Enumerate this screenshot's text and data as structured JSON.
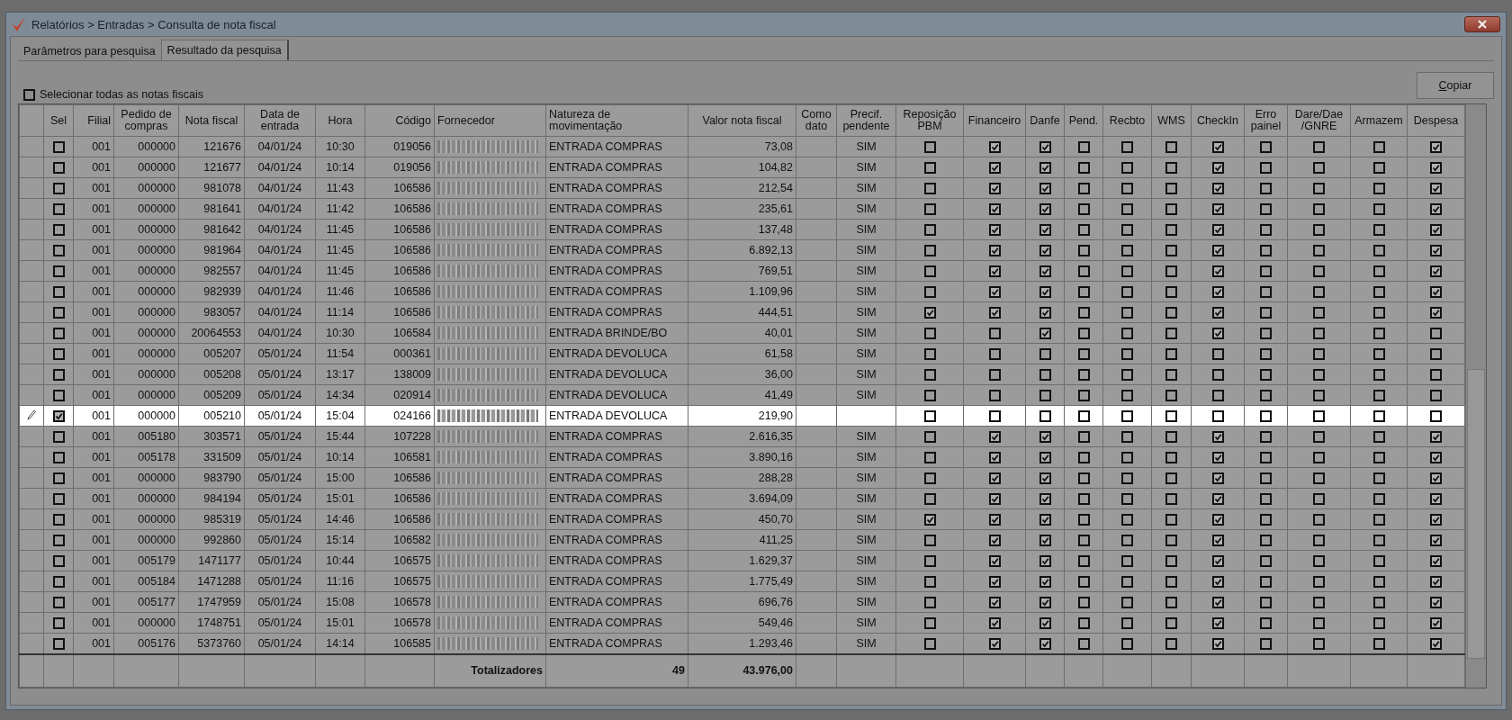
{
  "window": {
    "title": "Relatórios > Entradas > Consulta de nota fiscal"
  },
  "tabs": [
    {
      "label": "Parâmetros para pesquisa",
      "selected": false
    },
    {
      "label": "Resultado da pesquisa",
      "selected": true
    }
  ],
  "select_all": {
    "label": "Selecionar todas as notas fiscais",
    "checked": false
  },
  "copy_button": "Copiar",
  "table": {
    "columns": [
      "Sel",
      "Filial",
      "Pedido de\ncompras",
      "Nota fiscal",
      "Data de\nentrada",
      "Hora",
      "Código",
      "Fornecedor",
      "Natureza de\nmovimentação",
      "Valor nota fiscal",
      "Como\ndato",
      "Precif.\npendente",
      "Reposição\nPBM",
      "Financeiro",
      "Danfe",
      "Pend.",
      "Recbto",
      "WMS",
      "CheckIn",
      "Erro\npainel",
      "Dare/Dae\n/GNRE",
      "Armazem",
      "Despesa"
    ],
    "rows": [
      {
        "selected": false,
        "sel": false,
        "filial": "001",
        "pedido": "000000",
        "nota": "121676",
        "data": "04/01/24",
        "hora": "10:30",
        "codigo": "019056",
        "natureza": "ENTRADA COMPRAS",
        "valor": "73,08",
        "precif": "SIM",
        "checks": [
          false,
          true,
          true,
          false,
          false,
          false,
          true,
          false,
          false,
          false,
          true
        ]
      },
      {
        "selected": false,
        "sel": false,
        "filial": "001",
        "pedido": "000000",
        "nota": "121677",
        "data": "04/01/24",
        "hora": "10:14",
        "codigo": "019056",
        "natureza": "ENTRADA COMPRAS",
        "valor": "104,82",
        "precif": "SIM",
        "checks": [
          false,
          true,
          true,
          false,
          false,
          false,
          true,
          false,
          false,
          false,
          true
        ]
      },
      {
        "selected": false,
        "sel": false,
        "filial": "001",
        "pedido": "000000",
        "nota": "981078",
        "data": "04/01/24",
        "hora": "11:43",
        "codigo": "106586",
        "natureza": "ENTRADA COMPRAS",
        "valor": "212,54",
        "precif": "SIM",
        "checks": [
          false,
          true,
          true,
          false,
          false,
          false,
          true,
          false,
          false,
          false,
          true
        ]
      },
      {
        "selected": false,
        "sel": false,
        "filial": "001",
        "pedido": "000000",
        "nota": "981641",
        "data": "04/01/24",
        "hora": "11:42",
        "codigo": "106586",
        "natureza": "ENTRADA COMPRAS",
        "valor": "235,61",
        "precif": "SIM",
        "checks": [
          false,
          true,
          true,
          false,
          false,
          false,
          true,
          false,
          false,
          false,
          true
        ]
      },
      {
        "selected": false,
        "sel": false,
        "filial": "001",
        "pedido": "000000",
        "nota": "981642",
        "data": "04/01/24",
        "hora": "11:45",
        "codigo": "106586",
        "natureza": "ENTRADA COMPRAS",
        "valor": "137,48",
        "precif": "SIM",
        "checks": [
          false,
          true,
          true,
          false,
          false,
          false,
          true,
          false,
          false,
          false,
          true
        ]
      },
      {
        "selected": false,
        "sel": false,
        "filial": "001",
        "pedido": "000000",
        "nota": "981964",
        "data": "04/01/24",
        "hora": "11:45",
        "codigo": "106586",
        "natureza": "ENTRADA COMPRAS",
        "valor": "6.892,13",
        "precif": "SIM",
        "checks": [
          false,
          true,
          true,
          false,
          false,
          false,
          true,
          false,
          false,
          false,
          true
        ]
      },
      {
        "selected": false,
        "sel": false,
        "filial": "001",
        "pedido": "000000",
        "nota": "982557",
        "data": "04/01/24",
        "hora": "11:45",
        "codigo": "106586",
        "natureza": "ENTRADA COMPRAS",
        "valor": "769,51",
        "precif": "SIM",
        "checks": [
          false,
          true,
          true,
          false,
          false,
          false,
          true,
          false,
          false,
          false,
          true
        ]
      },
      {
        "selected": false,
        "sel": false,
        "filial": "001",
        "pedido": "000000",
        "nota": "982939",
        "data": "04/01/24",
        "hora": "11:46",
        "codigo": "106586",
        "natureza": "ENTRADA COMPRAS",
        "valor": "1.109,96",
        "precif": "SIM",
        "checks": [
          false,
          true,
          true,
          false,
          false,
          false,
          true,
          false,
          false,
          false,
          true
        ]
      },
      {
        "selected": false,
        "sel": false,
        "filial": "001",
        "pedido": "000000",
        "nota": "983057",
        "data": "04/01/24",
        "hora": "11:14",
        "codigo": "106586",
        "natureza": "ENTRADA COMPRAS",
        "valor": "444,51",
        "precif": "SIM",
        "checks": [
          true,
          true,
          true,
          false,
          false,
          false,
          true,
          false,
          false,
          false,
          true
        ]
      },
      {
        "selected": false,
        "sel": false,
        "filial": "001",
        "pedido": "000000",
        "nota": "20064553",
        "data": "04/01/24",
        "hora": "10:30",
        "codigo": "106584",
        "natureza": "ENTRADA BRINDE/BO",
        "valor": "40,01",
        "precif": "SIM",
        "checks": [
          false,
          false,
          true,
          false,
          false,
          false,
          true,
          false,
          false,
          false,
          false
        ]
      },
      {
        "selected": false,
        "sel": false,
        "filial": "001",
        "pedido": "000000",
        "nota": "005207",
        "data": "05/01/24",
        "hora": "11:54",
        "codigo": "000361",
        "natureza": "ENTRADA DEVOLUCA",
        "valor": "61,58",
        "precif": "SIM",
        "checks": [
          false,
          false,
          false,
          false,
          false,
          false,
          false,
          false,
          false,
          false,
          false
        ]
      },
      {
        "selected": false,
        "sel": false,
        "filial": "001",
        "pedido": "000000",
        "nota": "005208",
        "data": "05/01/24",
        "hora": "13:17",
        "codigo": "138009",
        "natureza": "ENTRADA DEVOLUCA",
        "valor": "36,00",
        "precif": "SIM",
        "checks": [
          false,
          false,
          false,
          false,
          false,
          false,
          false,
          false,
          false,
          false,
          false
        ]
      },
      {
        "selected": false,
        "sel": false,
        "filial": "001",
        "pedido": "000000",
        "nota": "005209",
        "data": "05/01/24",
        "hora": "14:34",
        "codigo": "020914",
        "natureza": "ENTRADA DEVOLUCA",
        "valor": "41,49",
        "precif": "SIM",
        "checks": [
          false,
          false,
          false,
          false,
          false,
          false,
          false,
          false,
          false,
          false,
          false
        ]
      },
      {
        "selected": true,
        "sel": true,
        "filial": "001",
        "pedido": "000000",
        "nota": "005210",
        "data": "05/01/24",
        "hora": "15:04",
        "codigo": "024166",
        "natureza": "ENTRADA DEVOLUCA",
        "valor": "219,90",
        "checks": [
          false,
          false,
          false,
          false,
          false,
          false,
          false,
          false,
          false,
          false,
          false
        ]
      },
      {
        "selected": false,
        "sel": false,
        "filial": "001",
        "pedido": "005180",
        "nota": "303571",
        "data": "05/01/24",
        "hora": "15:44",
        "codigo": "107228",
        "natureza": "ENTRADA COMPRAS",
        "valor": "2.616,35",
        "precif": "SIM",
        "checks": [
          false,
          true,
          true,
          false,
          false,
          false,
          true,
          false,
          false,
          false,
          true
        ]
      },
      {
        "selected": false,
        "sel": false,
        "filial": "001",
        "pedido": "005178",
        "nota": "331509",
        "data": "05/01/24",
        "hora": "10:14",
        "codigo": "106581",
        "natureza": "ENTRADA COMPRAS",
        "valor": "3.890,16",
        "precif": "SIM",
        "checks": [
          false,
          true,
          true,
          false,
          false,
          false,
          true,
          false,
          false,
          false,
          true
        ]
      },
      {
        "selected": false,
        "sel": false,
        "filial": "001",
        "pedido": "000000",
        "nota": "983790",
        "data": "05/01/24",
        "hora": "15:00",
        "codigo": "106586",
        "natureza": "ENTRADA COMPRAS",
        "valor": "288,28",
        "precif": "SIM",
        "checks": [
          false,
          true,
          true,
          false,
          false,
          false,
          true,
          false,
          false,
          false,
          true
        ]
      },
      {
        "selected": false,
        "sel": false,
        "filial": "001",
        "pedido": "000000",
        "nota": "984194",
        "data": "05/01/24",
        "hora": "15:01",
        "codigo": "106586",
        "natureza": "ENTRADA COMPRAS",
        "valor": "3.694,09",
        "precif": "SIM",
        "checks": [
          false,
          true,
          true,
          false,
          false,
          false,
          true,
          false,
          false,
          false,
          true
        ]
      },
      {
        "selected": false,
        "sel": false,
        "filial": "001",
        "pedido": "000000",
        "nota": "985319",
        "data": "05/01/24",
        "hora": "14:46",
        "codigo": "106586",
        "natureza": "ENTRADA COMPRAS",
        "valor": "450,70",
        "precif": "SIM",
        "checks": [
          true,
          true,
          true,
          false,
          false,
          false,
          true,
          false,
          false,
          false,
          true
        ]
      },
      {
        "selected": false,
        "sel": false,
        "filial": "001",
        "pedido": "000000",
        "nota": "992860",
        "data": "05/01/24",
        "hora": "15:14",
        "codigo": "106582",
        "natureza": "ENTRADA COMPRAS",
        "valor": "411,25",
        "precif": "SIM",
        "checks": [
          false,
          true,
          true,
          false,
          false,
          false,
          true,
          false,
          false,
          false,
          true
        ]
      },
      {
        "selected": false,
        "sel": false,
        "filial": "001",
        "pedido": "005179",
        "nota": "1471177",
        "data": "05/01/24",
        "hora": "10:44",
        "codigo": "106575",
        "natureza": "ENTRADA COMPRAS",
        "valor": "1.629,37",
        "precif": "SIM",
        "checks": [
          false,
          true,
          true,
          false,
          false,
          false,
          true,
          false,
          false,
          false,
          true
        ]
      },
      {
        "selected": false,
        "sel": false,
        "filial": "001",
        "pedido": "005184",
        "nota": "1471288",
        "data": "05/01/24",
        "hora": "11:16",
        "codigo": "106575",
        "natureza": "ENTRADA COMPRAS",
        "valor": "1.775,49",
        "precif": "SIM",
        "checks": [
          false,
          true,
          true,
          false,
          false,
          false,
          true,
          false,
          false,
          false,
          true
        ]
      },
      {
        "selected": false,
        "sel": false,
        "filial": "001",
        "pedido": "005177",
        "nota": "1747959",
        "data": "05/01/24",
        "hora": "15:08",
        "codigo": "106578",
        "natureza": "ENTRADA COMPRAS",
        "valor": "696,76",
        "precif": "SIM",
        "checks": [
          false,
          true,
          true,
          false,
          false,
          false,
          true,
          false,
          false,
          false,
          true
        ]
      },
      {
        "selected": false,
        "sel": false,
        "filial": "001",
        "pedido": "000000",
        "nota": "1748751",
        "data": "05/01/24",
        "hora": "15:01",
        "codigo": "106578",
        "natureza": "ENTRADA COMPRAS",
        "valor": "549,46",
        "precif": "SIM",
        "checks": [
          false,
          true,
          true,
          false,
          false,
          false,
          true,
          false,
          false,
          false,
          true
        ]
      },
      {
        "selected": false,
        "sel": false,
        "filial": "001",
        "pedido": "005176",
        "nota": "5373760",
        "data": "05/01/24",
        "hora": "14:14",
        "codigo": "106585",
        "natureza": "ENTRADA COMPRAS",
        "valor": "1.293,46",
        "precif": "SIM",
        "checks": [
          false,
          true,
          true,
          false,
          false,
          false,
          true,
          false,
          false,
          false,
          true
        ]
      }
    ],
    "totals": {
      "label": "Totalizadores",
      "count": "49",
      "value": "43.976,00"
    }
  }
}
